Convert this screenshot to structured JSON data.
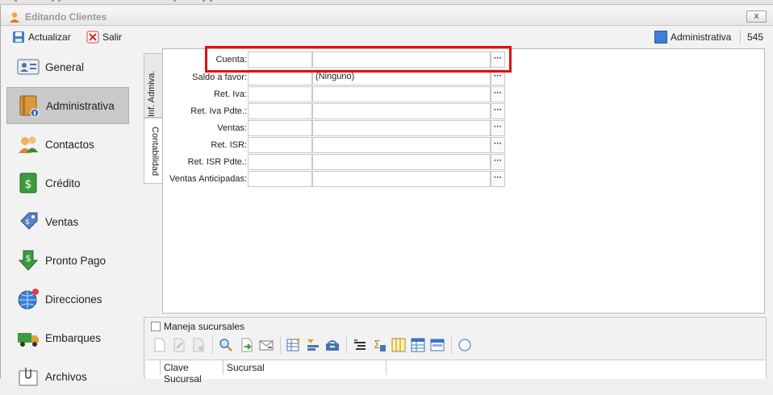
{
  "window": {
    "title": "Editando Clientes",
    "close_label": "x"
  },
  "toolbar": {
    "refresh_label": "Actualizar",
    "exit_label": "Salir",
    "module_name": "Administrativa",
    "module_color": "#3d7fd6",
    "record_number": "545"
  },
  "sidebar": {
    "items": [
      {
        "label": "General",
        "icon": "id-card-icon"
      },
      {
        "label": "Administrativa",
        "icon": "binder-info-icon"
      },
      {
        "label": "Contactos",
        "icon": "people-icon"
      },
      {
        "label": "Crédito",
        "icon": "money-book-icon"
      },
      {
        "label": "Ventas",
        "icon": "price-tag-icon"
      },
      {
        "label": "Pronto Pago",
        "icon": "dollar-down-arrow-icon"
      },
      {
        "label": "Direcciones",
        "icon": "globe-pin-icon"
      },
      {
        "label": "Embarques",
        "icon": "truck-icon"
      },
      {
        "label": "Archivos",
        "icon": "folder-clip-icon"
      }
    ],
    "active_index": 1
  },
  "tabs": {
    "admin": "Inf. Admiva.",
    "contabilidad": "Contabilidad"
  },
  "form": {
    "rows": [
      {
        "label": "Cuenta:",
        "code": "",
        "desc": ""
      },
      {
        "label": "Saldo a favor:",
        "code": "",
        "desc": "(Ninguno)"
      },
      {
        "label": "Ret. Iva:",
        "code": "",
        "desc": ""
      },
      {
        "label": "Ret. Iva Pdte.:",
        "code": "",
        "desc": ""
      },
      {
        "label": "Ventas:",
        "code": "",
        "desc": ""
      },
      {
        "label": "Ret. ISR:",
        "code": "",
        "desc": ""
      },
      {
        "label": "Ret. ISR Pdte.:",
        "code": "",
        "desc": ""
      },
      {
        "label": "Ventas Anticipadas:",
        "code": "",
        "desc": ""
      }
    ],
    "browse_label": "···"
  },
  "branches": {
    "checkbox_label": "Maneja sucursales",
    "columns": [
      "Clave Sucursal",
      "Sucursal"
    ]
  }
}
